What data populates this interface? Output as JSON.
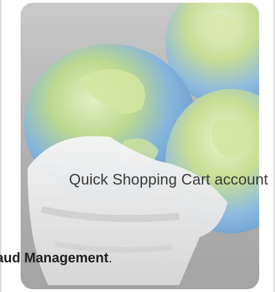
{
  "caption": "Quick Shopping Cart account",
  "instruction": {
    "bold_text": "aud Management",
    "trailing_text": "."
  },
  "icon": {
    "name": "globe-shopping-cart-icon",
    "colors": {
      "tile": "#b3b3b3",
      "globe_blue": "#6fa0cf",
      "globe_green": "#c4d98a",
      "cart_white": "#eeeeee"
    }
  }
}
